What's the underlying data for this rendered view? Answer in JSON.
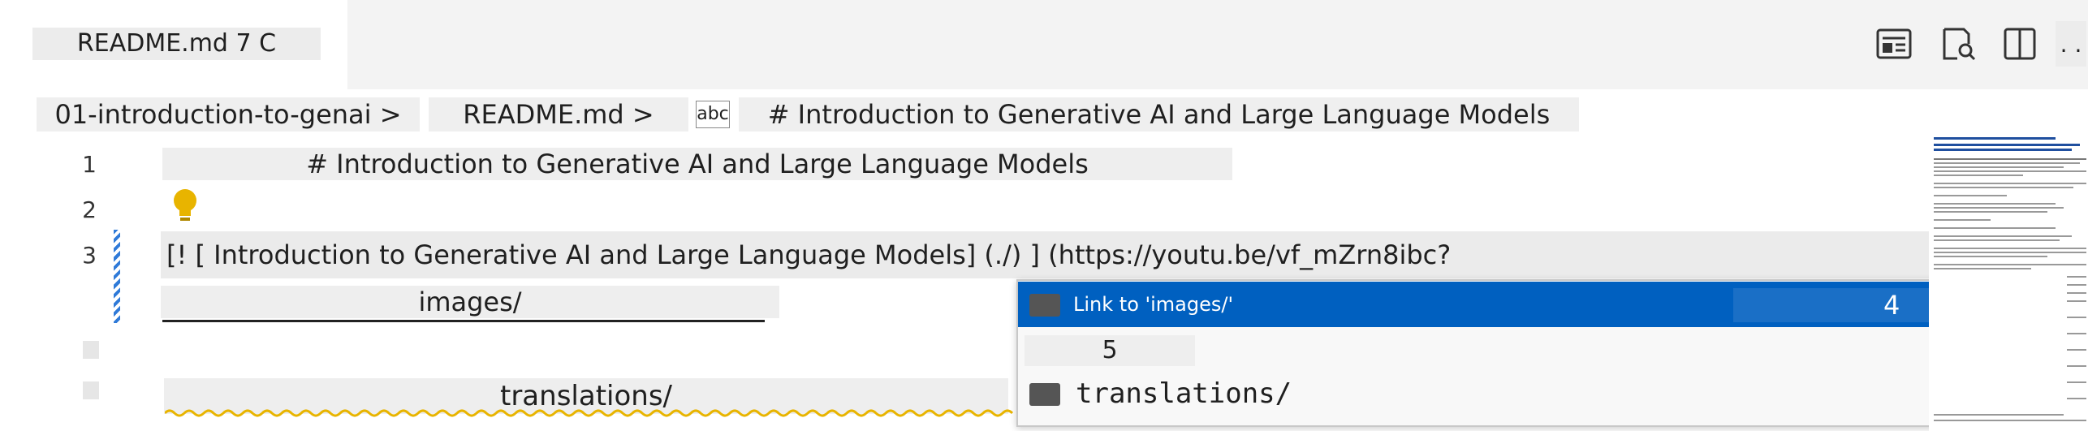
{
  "tab": {
    "label": "README.md 7 C"
  },
  "toolbar": {
    "icons": [
      "open-preview-icon",
      "preview-side-icon",
      "split-editor-icon",
      "more-actions-icon"
    ],
    "more_label": ". ."
  },
  "breadcrumbs": {
    "folder": "01-introduction-to-genai >",
    "file": "README.md >",
    "symbol_icon": "abc",
    "heading": "# Introduction to Generative AI and Large Language Models"
  },
  "editor": {
    "lines": [
      {
        "number": "1",
        "text": "# Introduction to Generative AI and Large Language Models"
      },
      {
        "number": "2",
        "text": ""
      },
      {
        "number": "3",
        "text": "[! [ Introduction to Generative AI and Large Language Models] (./) ] (https://youtu.be/vf_mZrn8ibc?"
      }
    ],
    "inline_suggestions": [
      "images/",
      "translations/"
    ]
  },
  "suggest": {
    "items": [
      {
        "label": "Link to 'images/'",
        "detail": "4",
        "selected": true
      },
      {
        "label": "5",
        "selected": false
      },
      {
        "label": "translations/",
        "selected": false
      }
    ]
  },
  "colors": {
    "accent": "#0060c0",
    "lightbulb": "#e8b400",
    "squiggle": "#e8b400"
  }
}
